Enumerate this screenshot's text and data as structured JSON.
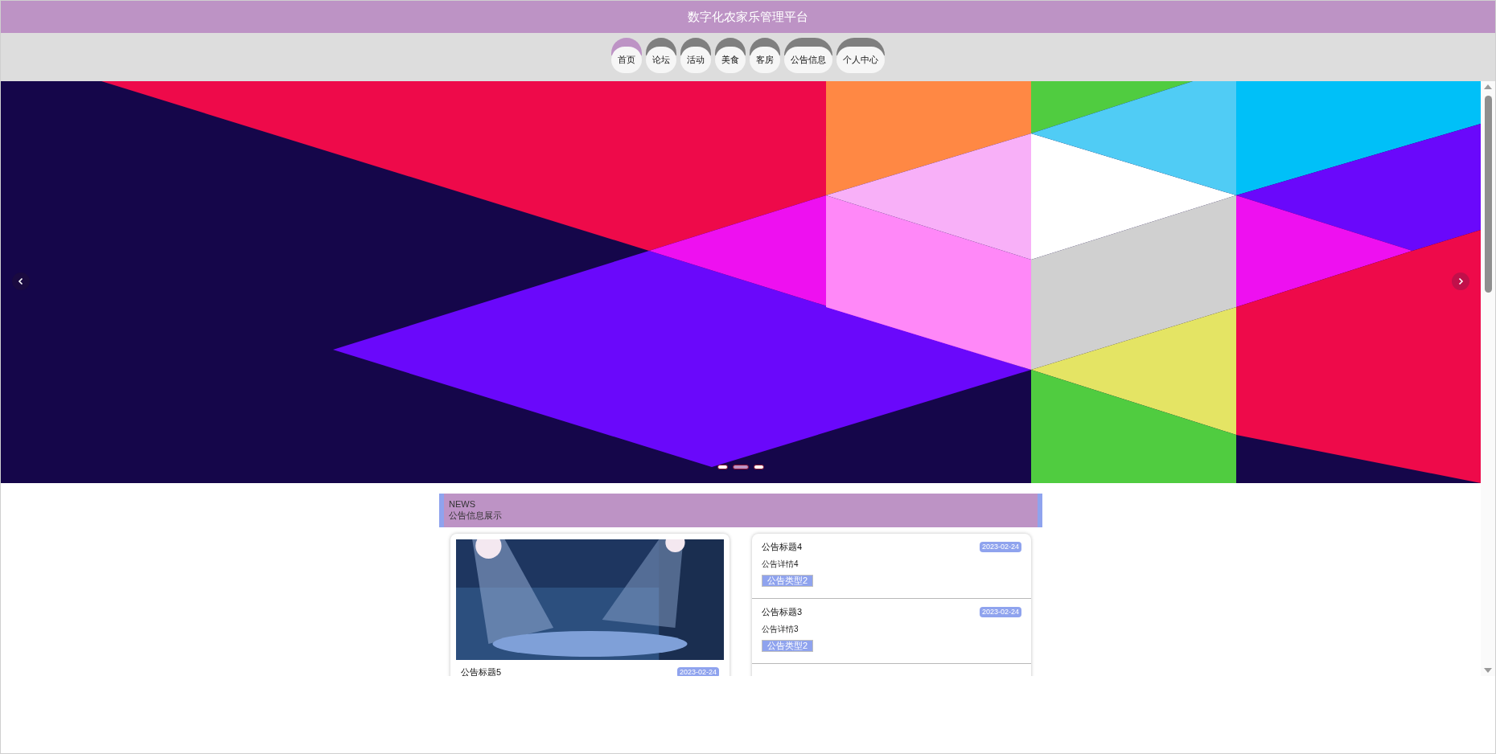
{
  "header": {
    "title": "数字化农家乐管理平台"
  },
  "nav": [
    {
      "label": "首页",
      "selected": true
    },
    {
      "label": "论坛",
      "selected": false
    },
    {
      "label": "活动",
      "selected": false
    },
    {
      "label": "美食",
      "selected": false
    },
    {
      "label": "客房",
      "selected": false
    },
    {
      "label": "公告信息",
      "selected": false
    },
    {
      "label": "个人中心",
      "selected": false
    }
  ],
  "carousel": {
    "dots": [
      {
        "selected": false
      },
      {
        "selected": true
      },
      {
        "selected": false
      }
    ]
  },
  "news": {
    "label": "NEWS",
    "title": "公告信息展示",
    "featured": {
      "title": "公告标题5",
      "date": "2023-02-24"
    },
    "items": [
      {
        "title": "公告标题4",
        "date": "2023-02-24",
        "detail": "公告详情4",
        "type": "公告类型2"
      },
      {
        "title": "公告标题3",
        "date": "2023-02-24",
        "detail": "公告详情3",
        "type": "公告类型2"
      }
    ]
  }
}
